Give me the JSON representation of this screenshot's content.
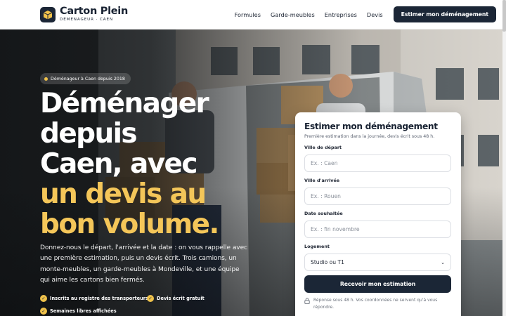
{
  "header": {
    "brand_name": "Carton Plein",
    "brand_sub": "DÉMÉNAGEUR · CAEN",
    "nav": [
      "Formules",
      "Garde-meubles",
      "Entreprises",
      "Devis"
    ],
    "cta_label": "Estimer mon déménagement"
  },
  "hero": {
    "badge": "Déménageur à Caen depuis 2018",
    "headline_lines": [
      "Déménager",
      "depuis",
      "Caen, avec"
    ],
    "headline_gold_lines": [
      "un devis au",
      "bon volume."
    ],
    "lead": "Donnez-nous le départ, l'arrivée et la date : on vous rappelle avec une première estimation, puis un devis écrit. Trois camions, un monte-meubles, un garde-meubles à Mondeville, et une équipe qui aime les cartons bien fermés.",
    "checks": [
      "Inscrits au registre des transporteurs",
      "Devis écrit gratuit",
      "Semaines libres affichées"
    ]
  },
  "form": {
    "title": "Estimer mon déménagement",
    "subtitle": "Première estimation dans la journée, devis écrit sous 48 h.",
    "fields": [
      {
        "label": "Ville de départ",
        "placeholder": "Ex. : Caen"
      },
      {
        "label": "Ville d'arrivée",
        "placeholder": "Ex. : Rouen"
      },
      {
        "label": "Date souhaitée",
        "placeholder": "Ex. : fin novembre"
      }
    ],
    "housing": {
      "label": "Logement",
      "value": "Studio ou T1"
    },
    "submit_label": "Recevoir mon estimation",
    "note": "Réponse sous 48 h. Vos coordonnées ne servent qu'à vous répondre."
  },
  "colors": {
    "navy": "#1b2636",
    "gold": "#f4c659",
    "badge_gold": "#f0c24b"
  },
  "icons": {
    "logo": "box-icon",
    "check": "check-circle-icon",
    "lock": "lock-icon",
    "select": "chevron-down-icon"
  }
}
